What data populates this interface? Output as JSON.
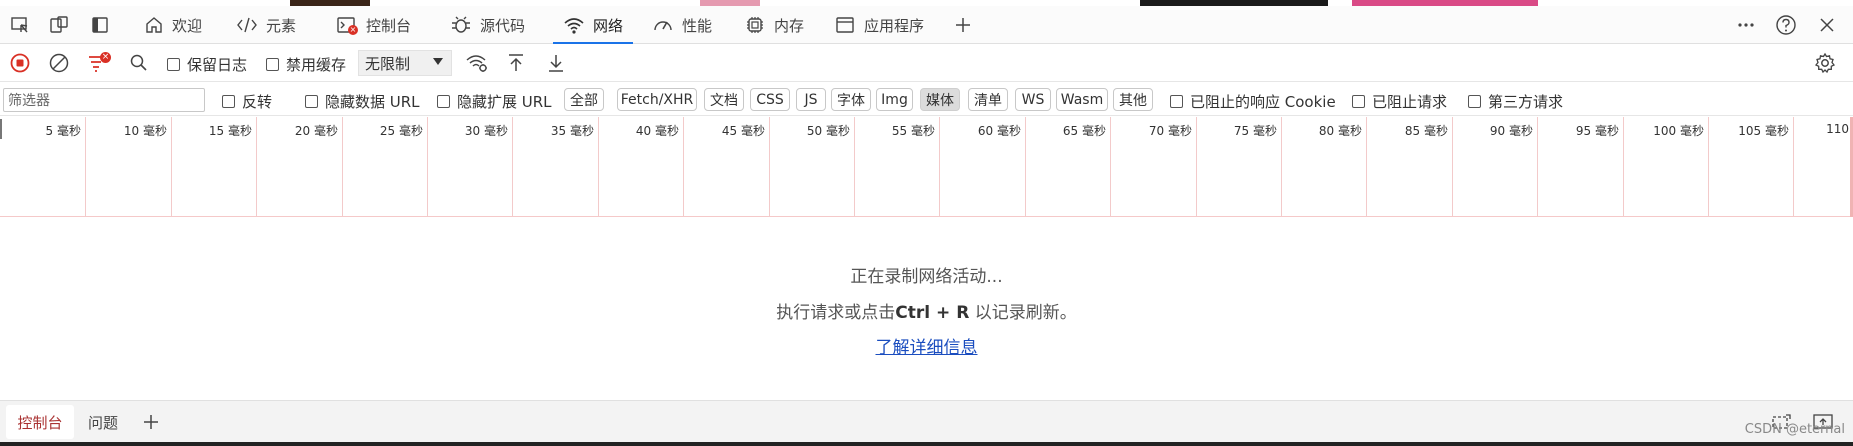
{
  "tabs": [
    {
      "label": "欢迎"
    },
    {
      "label": "元素"
    },
    {
      "label": "控制台"
    },
    {
      "label": "源代码"
    },
    {
      "label": "网络"
    },
    {
      "label": "性能"
    },
    {
      "label": "内存"
    },
    {
      "label": "应用程序"
    }
  ],
  "active_tab": "网络",
  "toolbar": {
    "preserve_log": "保留日志",
    "disable_cache": "禁用缓存",
    "throttling": "无限制"
  },
  "filter": {
    "placeholder": "筛选器",
    "invert": "反转",
    "hide_data_url": "隐藏数据 URL",
    "hide_extension_url": "隐藏扩展 URL",
    "types": [
      "全部",
      "Fetch/XHR",
      "文档",
      "CSS",
      "JS",
      "字体",
      "Img",
      "媒体",
      "清单",
      "WS",
      "Wasm",
      "其他"
    ],
    "selected_type": "媒体",
    "blocked_cookies": "已阻止的响应 Cookie",
    "blocked_requests": "已阻止请求",
    "third_party": "第三方请求"
  },
  "timeline": {
    "ticks": [
      "5 毫秒",
      "10 毫秒",
      "15 毫秒",
      "20 毫秒",
      "25 毫秒",
      "30 毫秒",
      "35 毫秒",
      "40 毫秒",
      "45 毫秒",
      "50 毫秒",
      "55 毫秒",
      "60 毫秒",
      "65 毫秒",
      "70 毫秒",
      "75 毫秒",
      "80 毫秒",
      "85 毫秒",
      "90 毫秒",
      "95 毫秒",
      "100 毫秒",
      "105 毫秒",
      "110"
    ]
  },
  "empty": {
    "recording": "正在录制网络活动...",
    "hint_prefix": "执行请求或点击",
    "hint_shortcut": "Ctrl + R",
    "hint_suffix": " 以记录刷新。",
    "learn_more": "了解详细信息"
  },
  "drawer": {
    "tabs": [
      "控制台",
      "问题"
    ]
  },
  "watermark": "CSDN @eternal",
  "colors": {
    "accent": "#1a73e8",
    "record_red": "#d93025",
    "link": "#1a4dbf",
    "grid_line": "#f3caca"
  }
}
